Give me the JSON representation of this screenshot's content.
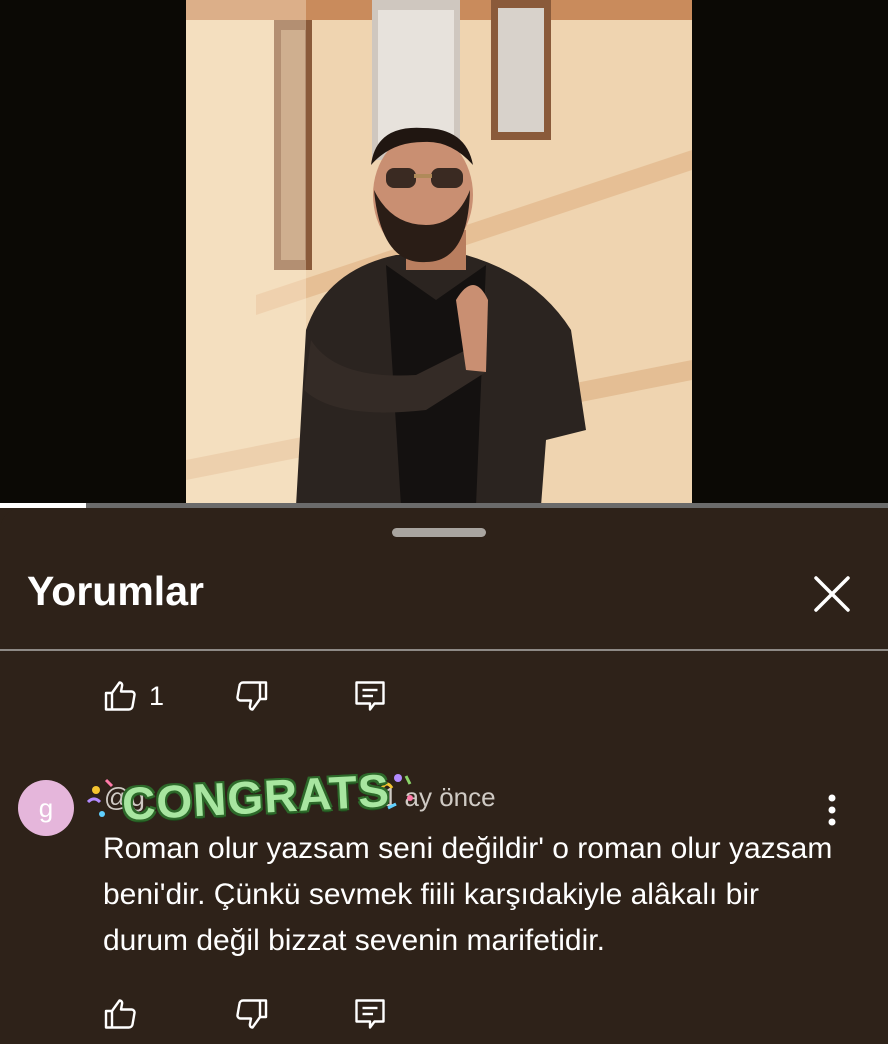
{
  "video": {
    "progress_fraction": 0.097,
    "thumbnail_alt": ""
  },
  "comments_sheet": {
    "title": "Yorumlar",
    "close_icon": "close-icon"
  },
  "previous_comment_actions": {
    "like_count": "1",
    "like_icon": "thumbs-up-icon",
    "dislike_icon": "thumbs-down-icon",
    "reply_icon": "reply-icon"
  },
  "comment": {
    "avatar_letter": "g",
    "author": "@g",
    "time": "1 ay önce",
    "sticker_text": "CONGRATS",
    "text": "Roman olur yazsam seni değildir' o roman olur yazsam beni'dir. Çünkü sevmek fiili karşıdakiyle alâkalı bir durum değil bizzat sevenin marifetidir.",
    "more_icon": "more-vertical-icon"
  },
  "comment_actions": {
    "like_icon": "thumbs-up-icon",
    "dislike_icon": "thumbs-down-icon",
    "reply_icon": "reply-icon"
  },
  "colors": {
    "sheet_bg": "#2e2219",
    "avatar_bg": "#e5b6db",
    "sticker_green": "#a8e6a0"
  }
}
